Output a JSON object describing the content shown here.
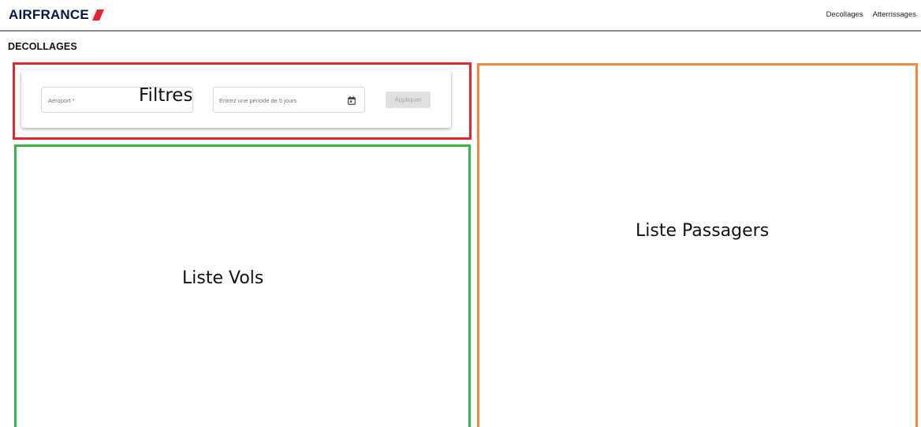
{
  "header": {
    "logo_text": "AIRFRANCE",
    "nav": {
      "departures": "Decollages",
      "arrivals": "Atterrissages"
    }
  },
  "page": {
    "title": "DECOLLAGES"
  },
  "filters": {
    "caption": "Filtres",
    "airport_label": "Aéroport *",
    "period_placeholder": "Entrez une période de 5 jours",
    "apply_label": "Appliquer"
  },
  "flights": {
    "caption": "Liste Vols"
  },
  "passengers": {
    "caption": "Liste Passagers"
  },
  "colors": {
    "brand": "#05164d",
    "brand_accent": "#e3262f",
    "filters_zone": "#e3262f",
    "flights_zone": "#3cb548",
    "passengers_zone": "#f2873b"
  },
  "icons": {
    "logo_mark": "airfrance-swoosh-icon",
    "period": "calendar-icon"
  }
}
